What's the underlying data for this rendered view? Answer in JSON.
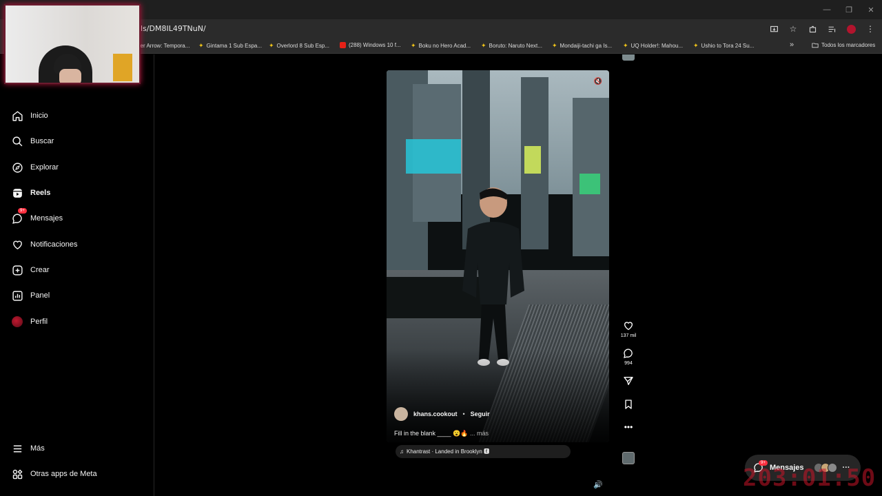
{
  "browser": {
    "url": "ls/DM8IL49TNuN/",
    "window_controls": {
      "minimize": "—",
      "restore": "❐",
      "close": "✕"
    },
    "bookmarks": [
      {
        "label": "er Arrow: Tempora...",
        "icon": "star-icon"
      },
      {
        "label": "Gintama 1 Sub Espa...",
        "icon": "star-icon"
      },
      {
        "label": "Overlord 8 Sub Esp...",
        "icon": "star-icon"
      },
      {
        "label": "(288) Windows 10 f...",
        "icon": "youtube-icon"
      },
      {
        "label": "Boku no Hero Acad...",
        "icon": "star-icon"
      },
      {
        "label": "Boruto: Naruto Next...",
        "icon": "star-icon"
      },
      {
        "label": "Mondaiji-tachi ga Is...",
        "icon": "star-icon"
      },
      {
        "label": "UQ Holder!: Mahou...",
        "icon": "star-icon"
      },
      {
        "label": "Ushio to Tora 24 Su...",
        "icon": "star-icon"
      }
    ],
    "bookmarks_overflow": "»",
    "all_bookmarks": "Todos los marcadores"
  },
  "sidebar": {
    "items": [
      {
        "label": "Inicio",
        "icon": "home-icon"
      },
      {
        "label": "Buscar",
        "icon": "search-icon"
      },
      {
        "label": "Explorar",
        "icon": "compass-icon"
      },
      {
        "label": "Reels",
        "icon": "reels-icon"
      },
      {
        "label": "Mensajes",
        "icon": "messenger-icon",
        "badge": "9+"
      },
      {
        "label": "Notificaciones",
        "icon": "heart-icon"
      },
      {
        "label": "Crear",
        "icon": "plus-square-icon"
      },
      {
        "label": "Panel",
        "icon": "chart-icon"
      },
      {
        "label": "Perfil",
        "icon": "avatar"
      }
    ],
    "bottom": [
      {
        "label": "Más",
        "icon": "menu-icon"
      },
      {
        "label": "Otras apps de Meta",
        "icon": "meta-apps-icon"
      }
    ]
  },
  "reel": {
    "author": "khans.cookout",
    "separator": "•",
    "follow": "Seguir",
    "caption": "Fill in the blank ____ 😮🔥",
    "more": "... más",
    "audio": "Khantrast · Landed in Brooklyn 🅴",
    "likes": "137 mil",
    "comments": "994",
    "mute_icon": "🔇"
  },
  "messages_bubble": {
    "label": "Mensajes",
    "badge": "9+",
    "more": "···"
  },
  "overlay_timer": "203:01:50"
}
